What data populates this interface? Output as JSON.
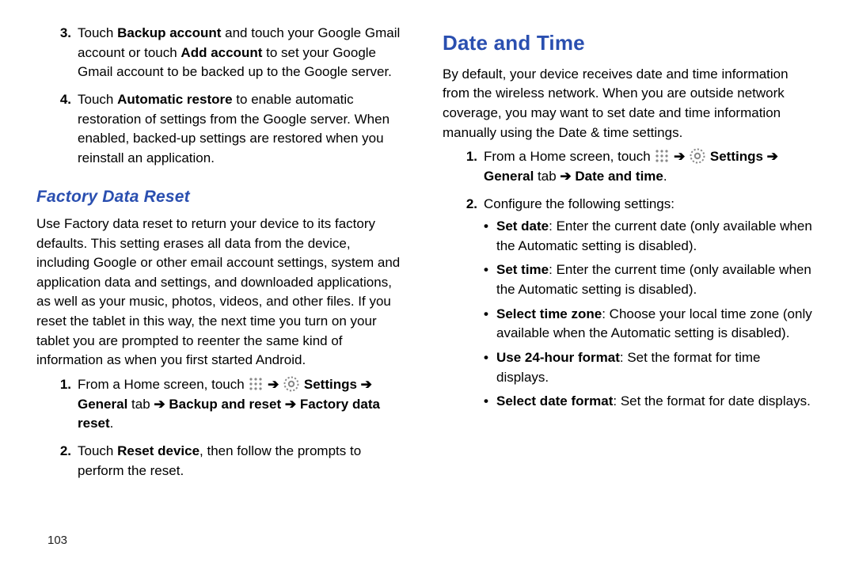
{
  "pageNumber": "103",
  "left": {
    "steps": [
      {
        "num": "3.",
        "pre": "Touch ",
        "b1": "Backup account",
        "mid1": " and touch your Google Gmail account or touch ",
        "b2": "Add account",
        "post": " to set your Google Gmail account to be backed up to the Google server."
      },
      {
        "num": "4.",
        "pre": "Touch ",
        "b1": "Automatic restore",
        "post": " to enable automatic restoration of settings from the Google server. When enabled, backed-up settings are restored when you reinstall an application."
      }
    ],
    "factoryHeading": "Factory Data Reset",
    "factoryPara": "Use Factory data reset to return your device to its factory defaults. This setting erases all data from the device, including Google or other email account settings, system and application data and settings, and downloaded applications, as well as your music, photos, videos, and other files. If you reset the tablet in this way, the next time you turn on your tablet you are prompted to reenter the same kind of information as when you first started Android.",
    "factorySteps": [
      {
        "num": "1.",
        "pre": "From a Home screen, touch ",
        "trail_b1": "Settings",
        "trail_b2": "General",
        "trail_tab": " tab ",
        "trail_b3": "Backup and reset",
        "trail_b4": "Factory data reset",
        "period": "."
      },
      {
        "num": "2.",
        "pre": "Touch ",
        "b1": "Reset device",
        "post": ", then follow the prompts to perform the reset."
      }
    ]
  },
  "right": {
    "heading": "Date and Time",
    "intro": "By default, your device receives date and time information from the wireless network. When you are outside network coverage, you may want to set date and time information manually using the Date & time settings.",
    "steps": [
      {
        "num": "1.",
        "pre": "From a Home screen, touch ",
        "trail_b1": "Settings",
        "trail_b2": "General",
        "trail_tab": " tab ",
        "trail_b3": "Date and time",
        "period": "."
      },
      {
        "num": "2.",
        "text": "Configure the following settings:"
      }
    ],
    "bullets": [
      {
        "b": "Set date",
        "t": ": Enter the current date (only available when the Automatic setting is disabled)."
      },
      {
        "b": "Set time",
        "t": ": Enter the current time (only available when the Automatic setting is disabled)."
      },
      {
        "b": "Select time zone",
        "t": ": Choose your local time zone (only available when the Automatic setting is disabled)."
      },
      {
        "b": "Use 24-hour format",
        "t": ": Set the format for time displays."
      },
      {
        "b": "Select date format",
        "t": ": Set the format for date displays."
      }
    ]
  },
  "glyph": {
    "arrow": "➔",
    "bullet": "•"
  }
}
